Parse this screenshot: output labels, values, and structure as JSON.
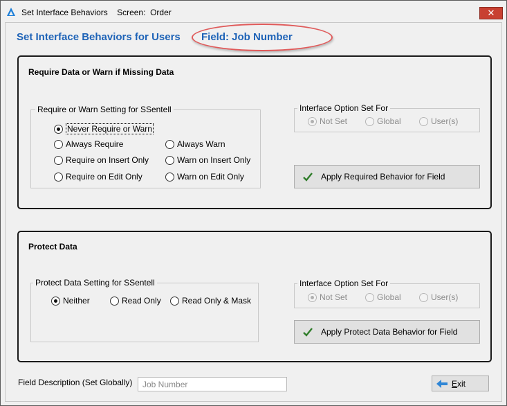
{
  "window": {
    "title": "Set Interface Behaviors    Screen:  Order",
    "close_label": "✕"
  },
  "header": {
    "title": "Set Interface Behaviors for Users",
    "field_label": "Field:  Job Number"
  },
  "require_section": {
    "title": "Require Data or Warn if Missing Data",
    "group_label": "Require or Warn Setting for SSentell",
    "options": [
      {
        "label": "Never Require or Warn",
        "selected": true
      },
      {
        "label": "Always Require",
        "selected": false
      },
      {
        "label": "Always Warn",
        "selected": false
      },
      {
        "label": "Require on Insert Only",
        "selected": false
      },
      {
        "label": "Warn on Insert Only",
        "selected": false
      },
      {
        "label": "Require on Edit Only",
        "selected": false
      },
      {
        "label": "Warn on Edit Only",
        "selected": false
      }
    ],
    "option_set": {
      "label": "Interface Option Set For",
      "options": [
        {
          "label": "Not Set",
          "selected": true
        },
        {
          "label": "Global",
          "selected": false
        },
        {
          "label": "User(s)",
          "selected": false
        }
      ]
    },
    "apply_button": "Apply Required Behavior for Field"
  },
  "protect_section": {
    "title": "Protect Data",
    "group_label": "Protect Data Setting for SSentell",
    "options": [
      {
        "label": "Neither",
        "selected": true
      },
      {
        "label": "Read Only",
        "selected": false
      },
      {
        "label": "Read Only & Mask",
        "selected": false
      }
    ],
    "option_set": {
      "label": "Interface Option Set For",
      "options": [
        {
          "label": "Not Set",
          "selected": true
        },
        {
          "label": "Global",
          "selected": false
        },
        {
          "label": "User(s)",
          "selected": false
        }
      ]
    },
    "apply_button": "Apply Protect Data Behavior for Field"
  },
  "footer": {
    "description_label": "Field Description (Set Globally)",
    "description_value": "Job Number",
    "exit_button": "Exit"
  },
  "colors": {
    "accent": "#1e63b7",
    "highlight": "#e05a5a",
    "check": "#2f7d2a",
    "close": "#c84031"
  }
}
